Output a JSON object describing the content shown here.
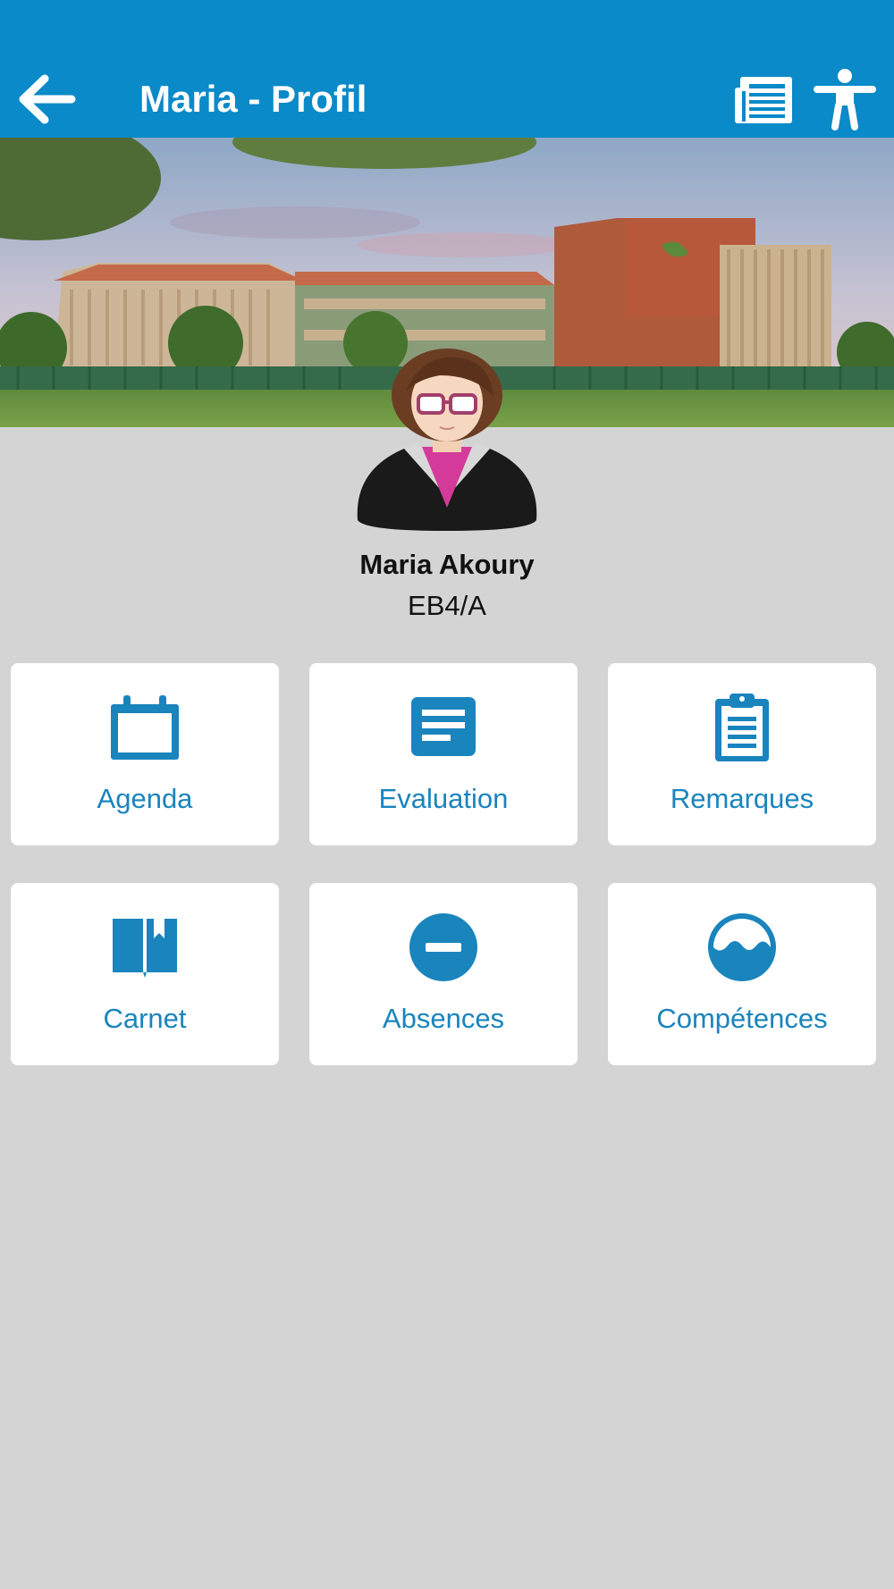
{
  "appbar": {
    "title": "Maria - Profil",
    "back_icon": "arrow-left-icon",
    "news_icon": "newspaper-icon",
    "accessibility_icon": "accessibility-icon",
    "color": "#0a8ac8"
  },
  "banner": {
    "image": "school-building-photo"
  },
  "profile": {
    "avatar_icon": "student-avatar",
    "name": "Maria Akoury",
    "class": "EB4/A"
  },
  "menu": {
    "accent": "#1a84bd",
    "items": [
      {
        "label": "Agenda",
        "icon": "calendar-icon"
      },
      {
        "label": "Evaluation",
        "icon": "note-icon"
      },
      {
        "label": "Remarques",
        "icon": "clipboard-icon"
      },
      {
        "label": "Carnet",
        "icon": "book-icon"
      },
      {
        "label": "Absences",
        "icon": "minus-circle-icon"
      },
      {
        "label": "Compétences",
        "icon": "waves-circle-icon"
      }
    ]
  }
}
